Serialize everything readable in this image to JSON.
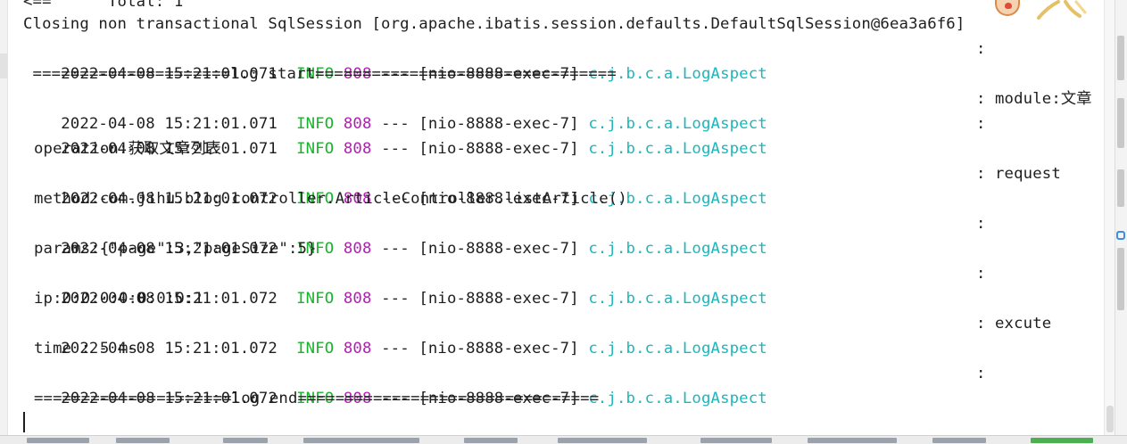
{
  "top_partial": "<==      Total: 1",
  "closing_line": "Closing non transactional SqlSession [org.apache.ibatis.session.defaults.DefaultSqlSession@6ea3a6f6]",
  "log_entries": [
    {
      "timestamp": "2022-04-08 15:21:01.071",
      "level": "INFO",
      "pid": "808",
      "sep": "---",
      "thread": "[nio-8888-exec-7]",
      "logger": "c.j.b.c.a.LogAspect",
      "colon": ":",
      "message": "",
      "continuation": " =====================log start================================"
    },
    {
      "timestamp": "2022-04-08 15:21:01.071",
      "level": "INFO",
      "pid": "808",
      "sep": "---",
      "thread": "[nio-8888-exec-7]",
      "logger": "c.j.b.c.a.LogAspect",
      "colon": ":",
      "message": "module:文章",
      "continuation": ""
    },
    {
      "timestamp": "2022-04-08 15:21:01.071",
      "level": "INFO",
      "pid": "808",
      "sep": "---",
      "thread": "[nio-8888-exec-7]",
      "logger": "c.j.b.c.a.LogAspect",
      "colon": ":",
      "message": "",
      "continuation": "operation:获取文章列表"
    },
    {
      "timestamp": "2022-04-08 15:21:01.072",
      "level": "INFO",
      "pid": "808",
      "sep": "---",
      "thread": "[nio-8888-exec-7]",
      "logger": "c.j.b.c.a.LogAspect",
      "colon": ":",
      "message": "request",
      "continuation": "method:com.jihu.blog.controller.ArticleController.listArticle()"
    },
    {
      "timestamp": "2022-04-08 15:21:01.072",
      "level": "INFO",
      "pid": "808",
      "sep": "---",
      "thread": "[nio-8888-exec-7]",
      "logger": "c.j.b.c.a.LogAspect",
      "colon": ":",
      "message": "",
      "continuation": "params:{\"page\":3,\"pageSize\":5}"
    },
    {
      "timestamp": "2022-04-08 15:21:01.072",
      "level": "INFO",
      "pid": "808",
      "sep": "---",
      "thread": "[nio-8888-exec-7]",
      "logger": "c.j.b.c.a.LogAspect",
      "colon": ":",
      "message": "",
      "continuation": "ip:0:0:0:0:0:0:0:1"
    },
    {
      "timestamp": "2022-04-08 15:21:01.072",
      "level": "INFO",
      "pid": "808",
      "sep": "---",
      "thread": "[nio-8888-exec-7]",
      "logger": "c.j.b.c.a.LogAspect",
      "colon": ":",
      "message": "excute",
      "continuation": "time : 5 ms"
    },
    {
      "timestamp": "2022-04-08 15:21:01.072",
      "level": "INFO",
      "pid": "808",
      "sep": "---",
      "thread": "[nio-8888-exec-7]",
      "logger": "c.j.b.c.a.LogAspect",
      "colon": ":",
      "message": "",
      "continuation": "=====================log end================================"
    }
  ],
  "colors": {
    "info_level": "#19b32b",
    "pid": "#b01fb0",
    "logger": "#1ab7bd",
    "text": "#1e1e1e",
    "background": "#ffffff"
  }
}
